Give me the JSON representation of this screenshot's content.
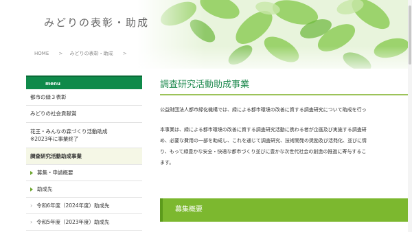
{
  "header": {
    "site_title": "みどりの表彰・助成",
    "breadcrumb": [
      "HOME",
      "みどりの表彰・助成"
    ],
    "breadcrumb_sep": ">"
  },
  "sidebar": {
    "menu_label": "menu",
    "items": [
      {
        "label": "都市の緑３表彰"
      },
      {
        "label": "みどりの社会貢献賞"
      },
      {
        "label": "花王・みんなの森づくり活動助成",
        "label2": "※2023年に事業終了"
      },
      {
        "label": "調査研究活動助成事業"
      }
    ],
    "sub_items": [
      {
        "label": "募集・申請概要"
      },
      {
        "label": "助成先"
      },
      {
        "label": "令和6年度（2024年度）助成先"
      },
      {
        "label": "令和5年度（2023年度）助成先"
      }
    ]
  },
  "main": {
    "title": "調査研究活動助成事業",
    "para1": "公益財団法人都市緑化機構では、緑による都市環境の改善に資する調査研究について助成を行っ",
    "para2_lines": [
      "本事業は、緑による都市環境の改善に資する調査研究活動に携わる者が企画及び実施する調査研",
      "め、必要な費用の一部を助成し、これを通じて調査研究、技術開発の奨励及び活発化、並びに情",
      "り、もって緑豊かな安全・快適な都市づくり並びに豊かな次世代社会の創造の推進に寄与するこ",
      "ます。"
    ],
    "section_heading": "募集概要"
  },
  "colors": {
    "accent_green": "#0f8a4a",
    "title_green": "#1f8a4f",
    "bar_green": "#7cb82f"
  }
}
